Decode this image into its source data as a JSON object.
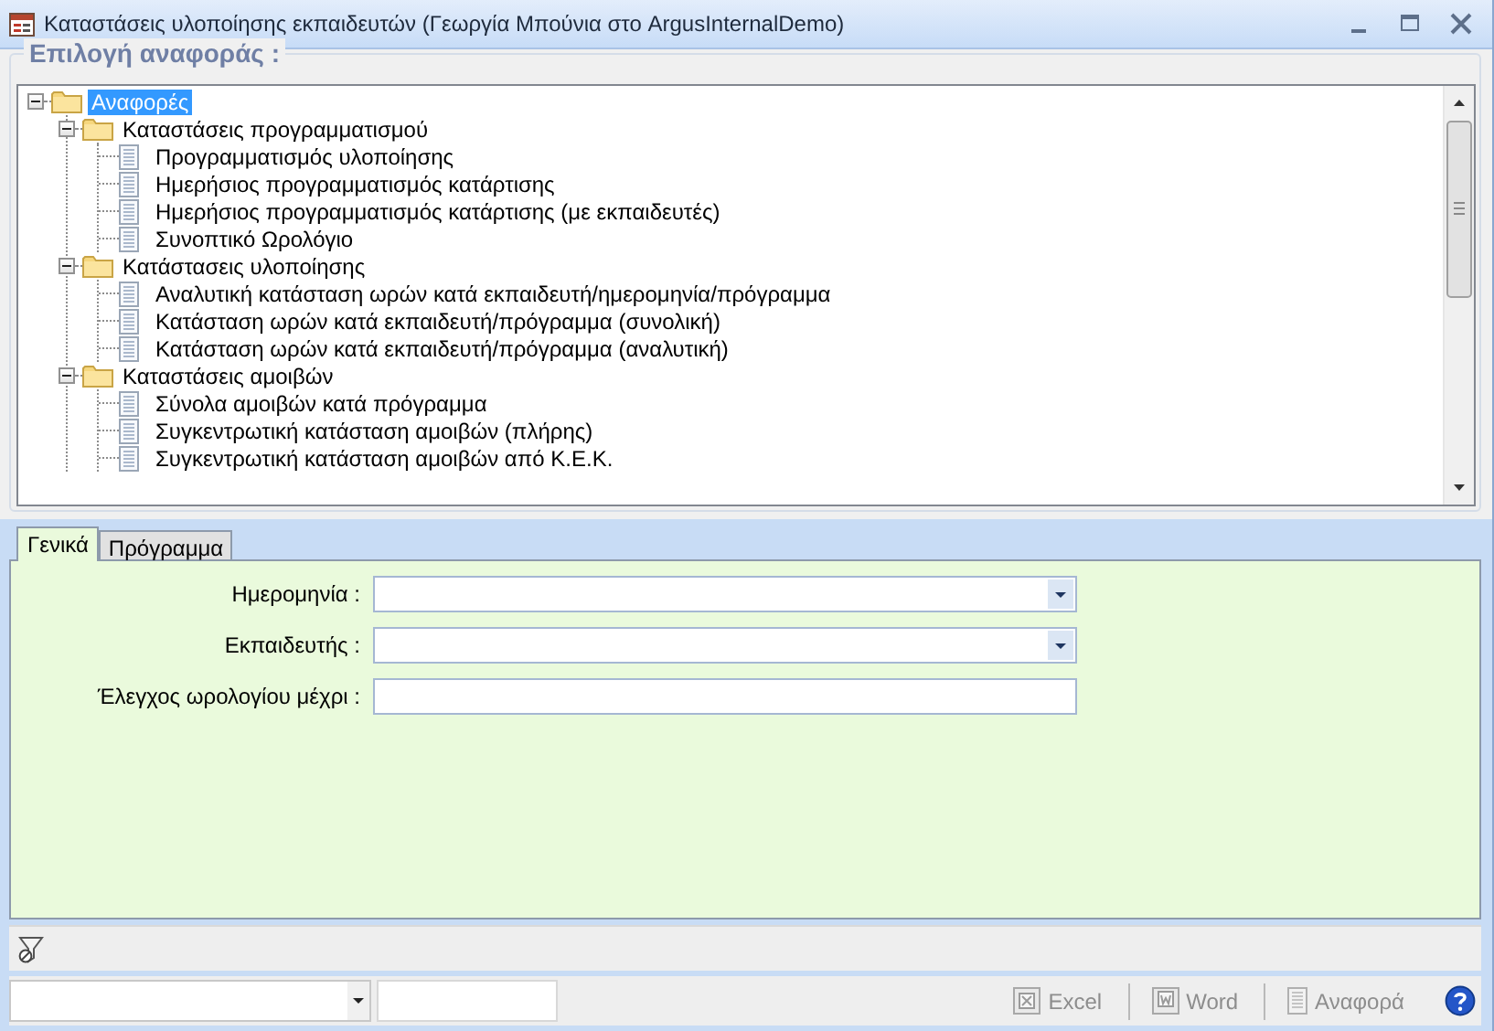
{
  "window": {
    "title": "Καταστάσεις υλοποίησης εκπαιδευτών (Γεωργία Μπούνια στο ArgusInternalDemo)"
  },
  "report_selection": {
    "legend": "Επιλογή αναφοράς :",
    "tree": [
      {
        "label": "Αναφορές",
        "kind": "folder",
        "expanded": true,
        "selected": true,
        "children": [
          {
            "label": "Καταστάσεις προγραμματισμού",
            "kind": "folder",
            "expanded": true,
            "selected": false,
            "children": [
              {
                "label": "Προγραμματισμός υλοποίησης",
                "kind": "report",
                "selected": false
              },
              {
                "label": "Ημερήσιος προγραμματισμός κατάρτισης",
                "kind": "report",
                "selected": false
              },
              {
                "label": "Ημερήσιος προγραμματισμός κατάρτισης (με εκπαιδευτές)",
                "kind": "report",
                "selected": false
              },
              {
                "label": "Συνοπτικό Ωρολόγιο",
                "kind": "report",
                "selected": false
              }
            ]
          },
          {
            "label": "Κατάστασεις υλοποίησης",
            "kind": "folder",
            "expanded": true,
            "selected": false,
            "children": [
              {
                "label": "Αναλυτική κατάσταση ωρών κατά εκπαιδευτή/ημερομηνία/πρόγραμμα",
                "kind": "report",
                "selected": false
              },
              {
                "label": "Κατάσταση ωρών κατά εκπαιδευτή/πρόγραμμα (συνολική)",
                "kind": "report",
                "selected": false
              },
              {
                "label": "Κατάσταση ωρών κατά εκπαιδευτή/πρόγραμμα (αναλυτική)",
                "kind": "report",
                "selected": false
              }
            ]
          },
          {
            "label": "Καταστάσεις αμοιβών",
            "kind": "folder",
            "expanded": true,
            "selected": false,
            "children": [
              {
                "label": "Σύνολα αμοιβών κατά πρόγραμμα",
                "kind": "report",
                "selected": false
              },
              {
                "label": "Συγκεντρωτική κατάσταση αμοιβών (πλήρης)",
                "kind": "report",
                "selected": false
              },
              {
                "label": "Συγκεντρωτική κατάσταση αμοιβών από Κ.Ε.Κ.",
                "kind": "report",
                "selected": false
              }
            ]
          }
        ]
      }
    ]
  },
  "tabs": [
    {
      "label": "Γενικά",
      "selected": true
    },
    {
      "label": "Πρόγραμμα",
      "selected": false
    }
  ],
  "fields": [
    {
      "label": "Ημερομηνία :",
      "kind": "combo"
    },
    {
      "label": "Εκπαιδευτής :",
      "kind": "combo"
    },
    {
      "label": "Έλεγχος ωρολογίου μέχρι :",
      "kind": "text"
    }
  ],
  "footer": {
    "buttons": [
      {
        "label": "Excel",
        "kind": "excel",
        "disabled": true
      },
      {
        "label": "Word",
        "kind": "word",
        "disabled": true
      },
      {
        "label": "Αναφορά",
        "kind": "report",
        "disabled": true
      }
    ]
  }
}
